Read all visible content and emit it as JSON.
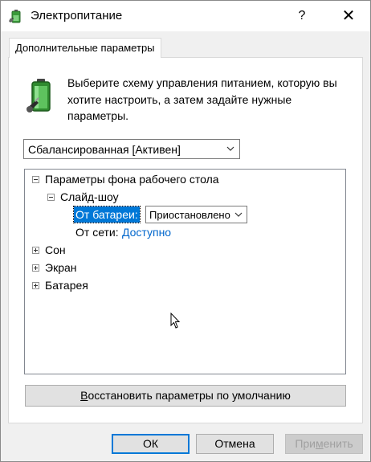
{
  "window": {
    "title": "Электропитание",
    "help_label": "?",
    "close_label": "✕"
  },
  "tab": {
    "label": "Дополнительные параметры"
  },
  "description": "Выберите схему управления питанием, которую вы хотите настроить, а затем задайте нужные параметры.",
  "scheme_select": {
    "value": "Сбалансированная [Активен]"
  },
  "tree": {
    "desktop_bg": "Параметры фона рабочего стола",
    "slideshow": "Слайд-шоу",
    "on_battery_label": "От батареи:",
    "on_battery_value": "Приостановлено",
    "plugged_in_label": "От сети:",
    "plugged_in_value": "Доступно",
    "sleep": "Сон",
    "display": "Экран",
    "battery": "Батарея"
  },
  "restore_button": {
    "accel": "В",
    "rest": "осстановить параметры по умолчанию"
  },
  "buttons": {
    "ok": "ОК",
    "cancel": "Отмена",
    "apply_pre": "При",
    "apply_accel": "м",
    "apply_post": "енить"
  },
  "colors": {
    "accent": "#0078d7",
    "link": "#0066cc"
  }
}
